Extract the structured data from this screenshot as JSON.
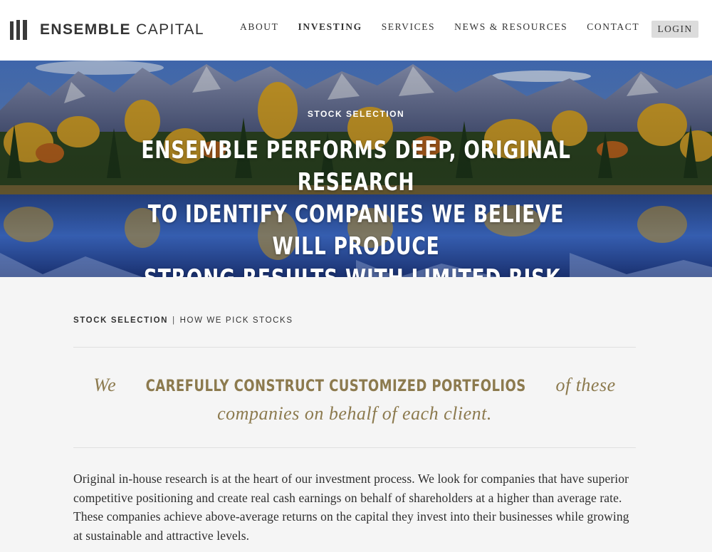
{
  "header": {
    "logo": {
      "bold": "ENSEMBLE",
      "light": "CAPITAL"
    },
    "nav": [
      {
        "label": "ABOUT"
      },
      {
        "label": "INVESTING"
      },
      {
        "label": "SERVICES"
      },
      {
        "label": "NEWS & RESOURCES"
      },
      {
        "label": "CONTACT"
      }
    ],
    "login_label": "LOGIN"
  },
  "hero": {
    "eyebrow": "STOCK SELECTION",
    "heading_line1": "Ensemble performs deep, original research",
    "heading_line2": "to identify companies we believe will produce",
    "heading_line3": "strong results with limited risk."
  },
  "breadcrumb": {
    "current": "STOCK SELECTION",
    "separator": "|",
    "sub": "HOW WE PICK STOCKS"
  },
  "quote": {
    "pre": "We",
    "emphasis": "carefully construct customized portfolios",
    "post_line1": "of these",
    "post_line2": "companies on behalf of each client."
  },
  "body": {
    "paragraph": "Original in-house research is at the heart of our investment process. We look for companies that have superior competitive positioning and create real cash earnings on behalf of shareholders at a higher than average rate. These companies achieve above-average returns on the capital they invest into their businesses while growing at sustainable and attractive levels."
  },
  "colors": {
    "accent_gold": "#8c7a4e",
    "header_bg": "#ffffff",
    "page_bg": "#f5f5f5",
    "login_bg": "#dcdcdc"
  }
}
